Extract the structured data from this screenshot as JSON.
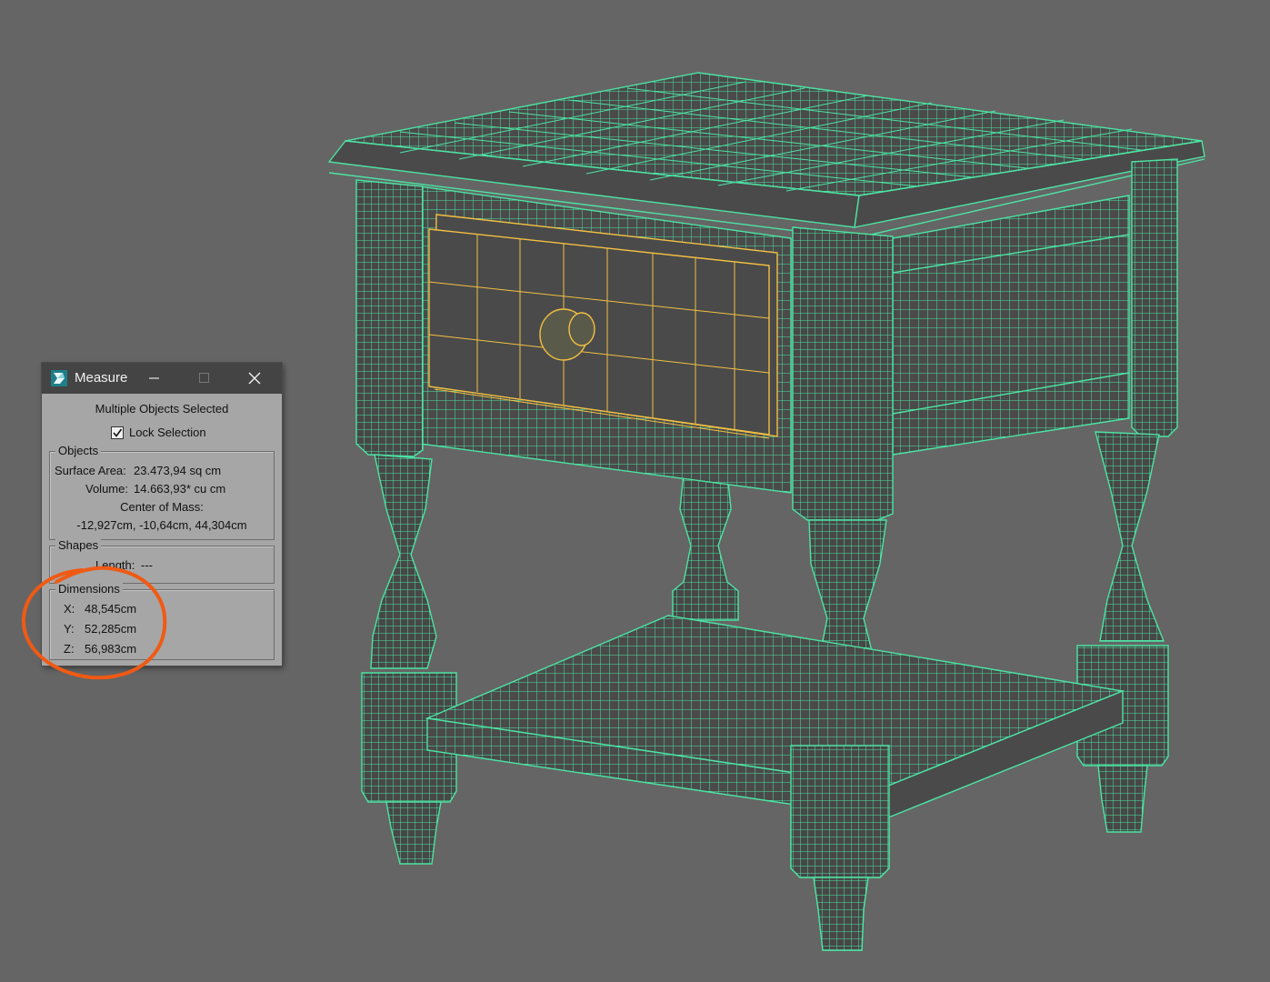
{
  "window": {
    "title": "Measure",
    "minimize_icon": "minimize-icon",
    "maximize_icon": "maximize-icon",
    "close_icon": "close-icon"
  },
  "selection": {
    "status": "Multiple Objects Selected",
    "lock_label": "Lock Selection",
    "lock_checked": true
  },
  "objects": {
    "group_title": "Objects",
    "surface_area_label": "Surface Area:",
    "surface_area_value": "23.473,94 sq cm",
    "volume_label": "Volume:",
    "volume_value": "14.663,93* cu cm",
    "center_of_mass_label": "Center of Mass:",
    "center_of_mass_value": "-12,927cm, -10,64cm, 44,304cm"
  },
  "shapes": {
    "group_title": "Shapes",
    "length_label": "Length:",
    "length_value": "---"
  },
  "dimensions": {
    "group_title": "Dimensions",
    "x_label": "X:",
    "x_value": "48,545cm",
    "y_label": "Y:",
    "y_value": "52,285cm",
    "z_label": "Z:",
    "z_value": "56,983cm"
  },
  "colors": {
    "viewport_bg": "#656565",
    "wireframe": "#4de3a4",
    "selected_wireframe": "#f2c042",
    "annotation": "#f05a14"
  }
}
